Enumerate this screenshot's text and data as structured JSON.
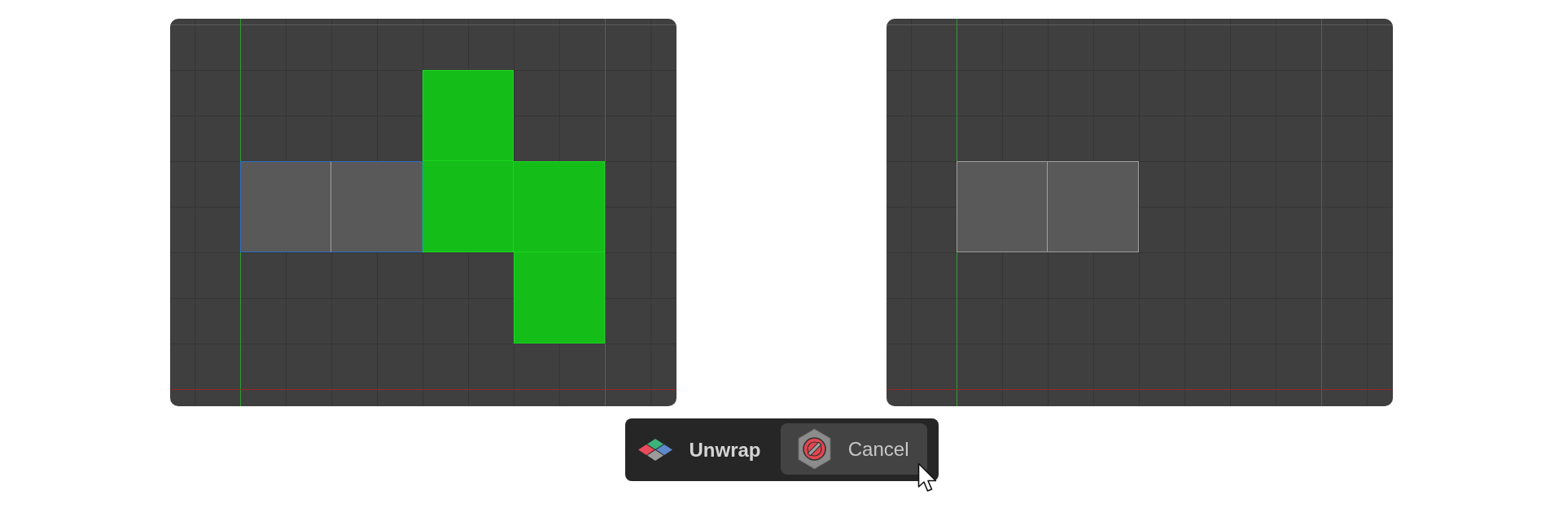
{
  "uv_editors": [
    {
      "rows": [
        {
          "cells": [
            {
              "kind": "empty"
            },
            {
              "kind": "empty"
            },
            {
              "kind": "face",
              "color": "#14bd18",
              "selected": false
            },
            {
              "kind": "empty"
            }
          ]
        },
        {
          "cells": [
            {
              "kind": "face",
              "color": "#595959",
              "selected": true
            },
            {
              "kind": "face",
              "color": "#595959",
              "selected": true
            },
            {
              "kind": "face",
              "color": "#14bd18",
              "selected": false
            },
            {
              "kind": "face",
              "color": "#14bd18",
              "selected": false
            }
          ]
        },
        {
          "cells": [
            {
              "kind": "empty"
            },
            {
              "kind": "empty"
            },
            {
              "kind": "empty"
            },
            {
              "kind": "face",
              "color": "#14bd18",
              "selected": false
            }
          ]
        }
      ]
    },
    {
      "rows": [
        {
          "cells": [
            {
              "kind": "empty"
            },
            {
              "kind": "empty"
            },
            {
              "kind": "empty"
            },
            {
              "kind": "empty"
            }
          ]
        },
        {
          "cells": [
            {
              "kind": "face",
              "color": "#595959",
              "selected": false
            },
            {
              "kind": "face",
              "color": "#595959",
              "selected": false
            },
            {
              "kind": "empty"
            },
            {
              "kind": "empty"
            }
          ]
        },
        {
          "cells": [
            {
              "kind": "empty"
            },
            {
              "kind": "empty"
            },
            {
              "kind": "empty"
            },
            {
              "kind": "empty"
            }
          ]
        }
      ]
    }
  ],
  "toolbar": {
    "command": "Unwrap",
    "cancel_button": {
      "label": "Cancel"
    }
  }
}
